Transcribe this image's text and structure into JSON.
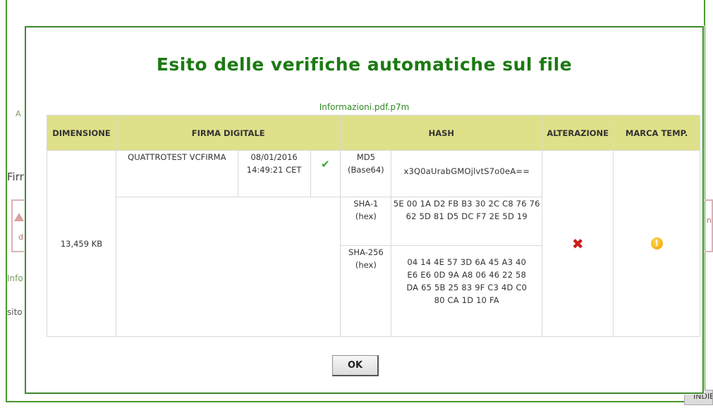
{
  "background": {
    "left_fragment_1": "A",
    "left_fragment_2": "Firm",
    "left_box_fragment": "di",
    "left_fragment_3": "Info",
    "left_fragment_4": "sito",
    "right_box_fragment": "n",
    "right_button_fragment": "INDIE"
  },
  "modal": {
    "title": "Esito delle verifiche automatiche sul file",
    "file_name": "Informazioni.pdf.p7m",
    "ok_label": "OK"
  },
  "table": {
    "headers": {
      "dimensione": "DIMENSIONE",
      "firma_digitale": "FIRMA DIGITALE",
      "hash": "HASH",
      "alterazione": "ALTERAZIONE",
      "marca_temp": "MARCA TEMP."
    },
    "dimensione": "13,459 KB",
    "firma": {
      "signer": "QUATTROTEST VCFIRMA",
      "date": "08/01/2016",
      "time": "14:49:21 CET",
      "status_icon": "check-icon",
      "status_color": "#3aa82c"
    },
    "hashes": [
      {
        "algorithm": "MD5",
        "encoding": "(Base64)",
        "value": "x3Q0aUrabGMOjlvtS7o0eA=="
      },
      {
        "algorithm": "SHA-1",
        "encoding": "(hex)",
        "value": "5E 00 1A D2 FB B3 30 2C C8 76 76 62 5D 81 D5 DC F7 2E 5D 19"
      },
      {
        "algorithm": "SHA-256",
        "encoding": "(hex)",
        "value": "04 14 4E 57 3D 6A 45 A3 40 E6 E6 0D 9A A8 06 46 22 58 DA 65 5B 25 83 9F C3 4D C0 80 CA 1D 10 FA"
      }
    ],
    "alterazione_icon": "x-icon",
    "alterazione_color": "#cc1b1b",
    "marca_icon": "warning-icon",
    "marca_color": "#f0a000"
  },
  "colors": {
    "title_green": "#1b7a12",
    "header_bg": "#dfe08a",
    "modal_border": "#3c8a2e"
  }
}
